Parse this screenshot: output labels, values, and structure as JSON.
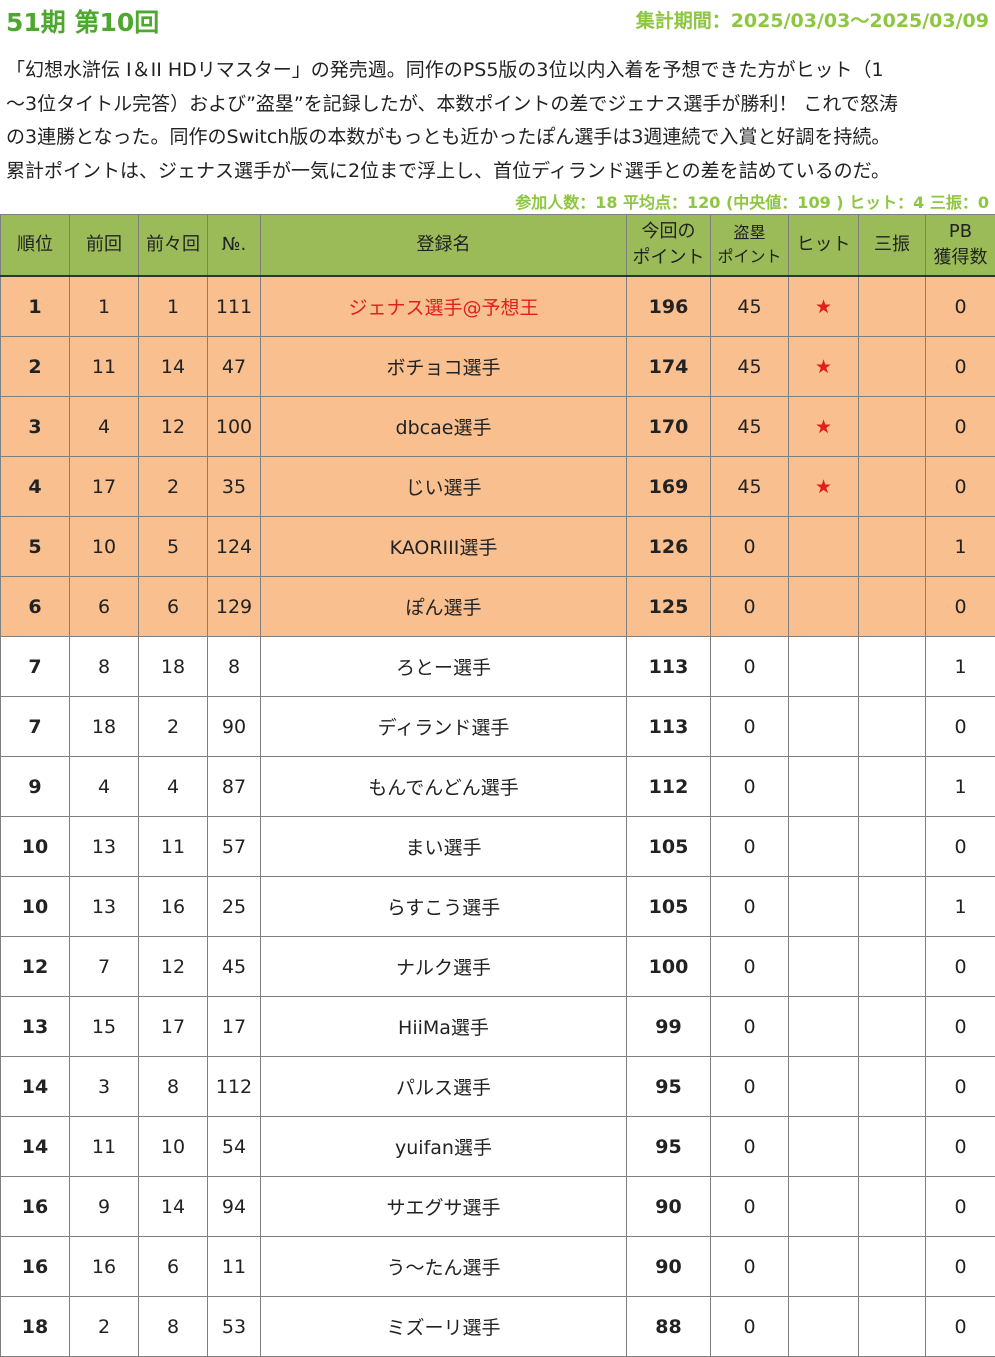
{
  "header": {
    "title": "51期 第10回",
    "period": "集計期間：2025/03/03～2025/03/09"
  },
  "description": [
    "「幻想水滸伝 I＆II HDリマスター」の発売週。同作のPS5版の3位以内入着を予想できた方がヒット（1",
    "～3位タイトル完答）および”盗塁”を記録したが、本数ポイントの差でジェナス選手が勝利！ これで怒涛",
    "の3連勝となった。同作のSwitch版の本数がもっとも近かったぽん選手は3週連続で入賞と好調を持続。",
    "累計ポイントは、ジェナス選手が一気に2位まで浮上し、首位ディランド選手との差を詰めているのだ。"
  ],
  "stats": "参加人数：18 平均点：120 (中央値：109 ) ヒット：4 三振：0",
  "table": {
    "headers": {
      "rank": "順位",
      "prev": "前回",
      "prev2": "前々回",
      "no": "№.",
      "name": "登録名",
      "points_line1": "今回の",
      "points_line2": "ポイント",
      "steal_line1": "盗塁",
      "steal_line2": "ポイント",
      "hit": "ヒット",
      "strikeout": "三振",
      "pb_line1": "PB",
      "pb_line2": "獲得数"
    },
    "hit_mark": "★",
    "rows": [
      {
        "rank": "1",
        "prev": "1",
        "prev2": "1",
        "no": "111",
        "name": "ジェナス選手@予想王",
        "points": "196",
        "steal": "45",
        "hit": true,
        "strikeout": "",
        "pb": "0",
        "top": true,
        "highlight": true
      },
      {
        "rank": "2",
        "prev": "11",
        "prev2": "14",
        "no": "47",
        "name": "ボチョコ選手",
        "points": "174",
        "steal": "45",
        "hit": true,
        "strikeout": "",
        "pb": "0",
        "top": true
      },
      {
        "rank": "3",
        "prev": "4",
        "prev2": "12",
        "no": "100",
        "name": "dbcae選手",
        "points": "170",
        "steal": "45",
        "hit": true,
        "strikeout": "",
        "pb": "0",
        "top": true
      },
      {
        "rank": "4",
        "prev": "17",
        "prev2": "2",
        "no": "35",
        "name": "じい選手",
        "points": "169",
        "steal": "45",
        "hit": true,
        "strikeout": "",
        "pb": "0",
        "top": true
      },
      {
        "rank": "5",
        "prev": "10",
        "prev2": "5",
        "no": "124",
        "name": "KAORIII選手",
        "points": "126",
        "steal": "0",
        "hit": false,
        "strikeout": "",
        "pb": "1",
        "top": true
      },
      {
        "rank": "6",
        "prev": "6",
        "prev2": "6",
        "no": "129",
        "name": "ぽん選手",
        "points": "125",
        "steal": "0",
        "hit": false,
        "strikeout": "",
        "pb": "0",
        "top": true
      },
      {
        "rank": "7",
        "prev": "8",
        "prev2": "18",
        "no": "8",
        "name": "ろとー選手",
        "points": "113",
        "steal": "0",
        "hit": false,
        "strikeout": "",
        "pb": "1"
      },
      {
        "rank": "7",
        "prev": "18",
        "prev2": "2",
        "no": "90",
        "name": "ディランド選手",
        "points": "113",
        "steal": "0",
        "hit": false,
        "strikeout": "",
        "pb": "0"
      },
      {
        "rank": "9",
        "prev": "4",
        "prev2": "4",
        "no": "87",
        "name": "もんでんどん選手",
        "points": "112",
        "steal": "0",
        "hit": false,
        "strikeout": "",
        "pb": "1"
      },
      {
        "rank": "10",
        "prev": "13",
        "prev2": "11",
        "no": "57",
        "name": "まい選手",
        "points": "105",
        "steal": "0",
        "hit": false,
        "strikeout": "",
        "pb": "0"
      },
      {
        "rank": "10",
        "prev": "13",
        "prev2": "16",
        "no": "25",
        "name": "らすこう選手",
        "points": "105",
        "steal": "0",
        "hit": false,
        "strikeout": "",
        "pb": "1"
      },
      {
        "rank": "12",
        "prev": "7",
        "prev2": "12",
        "no": "45",
        "name": "ナルク選手",
        "points": "100",
        "steal": "0",
        "hit": false,
        "strikeout": "",
        "pb": "0"
      },
      {
        "rank": "13",
        "prev": "15",
        "prev2": "17",
        "no": "17",
        "name": "HiiMa選手",
        "points": "99",
        "steal": "0",
        "hit": false,
        "strikeout": "",
        "pb": "0"
      },
      {
        "rank": "14",
        "prev": "3",
        "prev2": "8",
        "no": "112",
        "name": "パルス選手",
        "points": "95",
        "steal": "0",
        "hit": false,
        "strikeout": "",
        "pb": "0"
      },
      {
        "rank": "14",
        "prev": "11",
        "prev2": "10",
        "no": "54",
        "name": "yuifan選手",
        "points": "95",
        "steal": "0",
        "hit": false,
        "strikeout": "",
        "pb": "0"
      },
      {
        "rank": "16",
        "prev": "9",
        "prev2": "14",
        "no": "94",
        "name": "サエグサ選手",
        "points": "90",
        "steal": "0",
        "hit": false,
        "strikeout": "",
        "pb": "0"
      },
      {
        "rank": "16",
        "prev": "16",
        "prev2": "6",
        "no": "11",
        "name": "う～たん選手",
        "points": "90",
        "steal": "0",
        "hit": false,
        "strikeout": "",
        "pb": "0"
      },
      {
        "rank": "18",
        "prev": "2",
        "prev2": "8",
        "no": "53",
        "name": "ミズーリ選手",
        "points": "88",
        "steal": "0",
        "hit": false,
        "strikeout": "",
        "pb": "0"
      }
    ]
  },
  "colors": {
    "title_green": "#4ea72e",
    "accent_green": "#8dc63f",
    "header_bg": "#9bbb59",
    "top_row_bg": "#f9bf8f",
    "highlight_red": "#e0201b"
  }
}
